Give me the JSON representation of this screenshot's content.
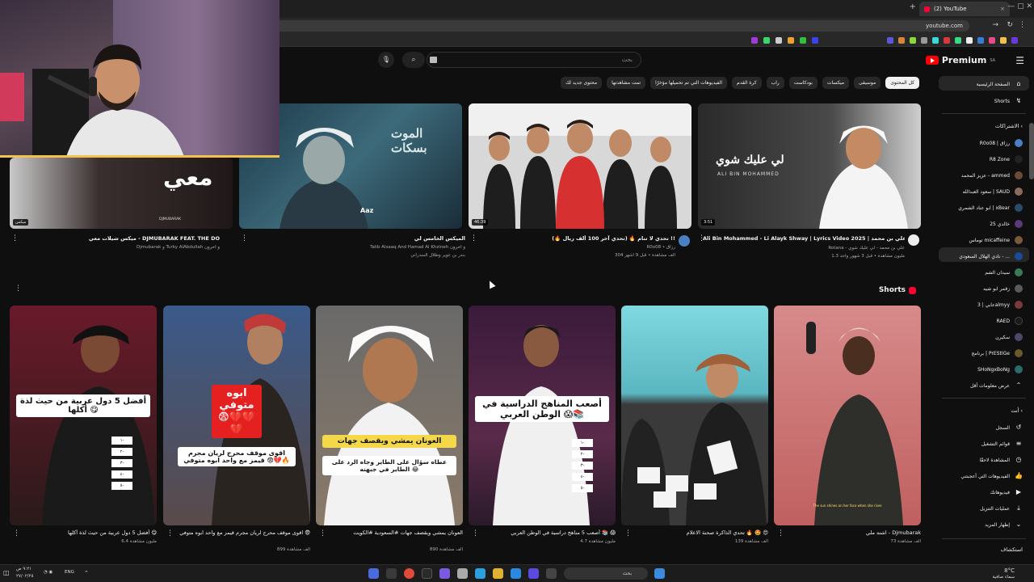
{
  "browser": {
    "tab_title": "(2) YouTube",
    "address": "youtube.com",
    "new_tab": "+",
    "tab_close": "×"
  },
  "header": {
    "logo_text": "Premium",
    "logo_sup": "SA",
    "search_placeholder": "بحث",
    "search_icon": "search-icon",
    "mic_icon": "mic-icon"
  },
  "chips": [
    {
      "label": "كل المحتوى",
      "active": true
    },
    {
      "label": "موسيقى"
    },
    {
      "label": "ميكسات"
    },
    {
      "label": "بودكاست"
    },
    {
      "label": "راب"
    },
    {
      "label": "كرة القدم"
    },
    {
      "label": "الفيديوهات التي تم تحميلها مؤخرًا"
    },
    {
      "label": "تمت مشاهدتها"
    },
    {
      "label": "محتوى جديد لك"
    }
  ],
  "videos": [
    {
      "title": "Ali Bin Mohammed - Li Alayk Shway | Lyrics Video 2025 | علي بن محمد -",
      "channel": "Rotana - علي بن محمد - لي عليك شوي",
      "meta": "1.3 مليون مشاهدة • قبل 3 شهور واحد",
      "duration": "3:51",
      "thumb_text": "لي عليك شوي",
      "thumb_sub": "ALI BIN MOHAMMED"
    },
    {
      "title": "تحدي لا تنام 🔥 (تحدي آخر 100 ألف ريال 🔥) !!",
      "channel": "R0o08 • رزاق",
      "meta": "304 ألف مشاهدة • قبل 9 أشهر",
      "duration": "46:39",
      "thumb_text": "",
      "thumb_sub": ""
    },
    {
      "title": "الميكس الخامس لي",
      "channel": "Talib Alsaaq And Hamad Al Khzineh و آخرون",
      "meta": "بندر بن عوير وطلال السدراني",
      "duration": "",
      "thumb_text": "الموت بسكات",
      "thumb_sub": "Aaz"
    },
    {
      "title": "ميكس شيلات معي - DJMUBARAK FEAT. THE DO",
      "channel": "Djmubarak و Turky AlAbdullah و آخرون",
      "meta": "",
      "duration": "ميكس",
      "thumb_text": "معي",
      "thumb_sub": "DJMUBARAK"
    }
  ],
  "shorts_header": "Shorts",
  "shorts": [
    {
      "caption": "",
      "title": "اشنه ملي - Djmubarak",
      "views": "73 ألف مشاهدة"
    },
    {
      "caption": "",
      "title": "تحدي الذاكرة صحنة الاعلام 🔥 🤩 😍",
      "views": "139 ألف مشاهدة"
    },
    {
      "caption": "أصعب المناهج الدراسية في الوطن العربي 😱📚",
      "title": "أصعب 5 مناهج دراسية في الوطن العربي 📚 😱",
      "views": "4.7 مليون مشاهدة"
    },
    {
      "caption": "العونان يمشي ويقصف جهات",
      "title": "العونان يمشي ويقصف جهات #السعودية #الكويت",
      "views": "890 ألف مشاهدة"
    },
    {
      "caption": "ابوه متوفي 😨💔💔💔",
      "title": "اقوى موقف محرج لريان مجرم قيمز مع واحد ابوه متوفي 😨",
      "views": "899 ألف مشاهدة"
    },
    {
      "caption": "أفضل 5 دول عربية من حيث لذة أكلها 😋",
      "title": "أفضل 5 دول عربية من حيث لذة أكلها 😋",
      "views": "6.4 مليون مشاهدة"
    }
  ],
  "short_captions_extra": {
    "s3_sub": "عطاه سؤال على الطاير وجاه الرد على الطاير في جبهته 😂",
    "s4_sub": "اقوى موقف محرج لريان مجرم قيمز مع واحد ابوه متوفي 😨💔🔥",
    "s1_bottom": "The sun shines on her face when she rises",
    "list_items": [
      "١-",
      "٢-",
      "٣-",
      "٤-",
      "٥-"
    ]
  },
  "sidebar": {
    "home": "الصفحة الرئيسية",
    "shorts": "Shorts",
    "subs_header": "الاشتراكات",
    "subscriptions": [
      {
        "label": "R0o08 | رزاق",
        "color": "#4a7fc1"
      },
      {
        "label": "R8 Zone",
        "color": "#222"
      },
      {
        "label": "عزيز المحمد - ammed",
        "color": "#6b4a3a"
      },
      {
        "label": "سعود العبدالله | SAUD",
        "color": "#8a6a5a"
      },
      {
        "label": "ابو عناد الشمري | xBear",
        "color": "#2a4a6a"
      },
      {
        "label": "خالدي 25",
        "color": "#5a3a7a"
      },
      {
        "label": "توماس micaffeine",
        "color": "#7a5a3a"
      },
      {
        "label": "نادي الهلال السعودي - ...",
        "color": "#1a4a9a"
      },
      {
        "label": "سيدان الشم",
        "color": "#3a7a5a"
      },
      {
        "label": "زقمر ابو شيه",
        "color": "#5a5a5a"
      },
      {
        "label": "عابي | 3almyy",
        "color": "#7a3a3a"
      },
      {
        "label": "RAED",
        "color": "#1a1a1a"
      },
      {
        "label": "سكيرن",
        "color": "#4a4a6a"
      },
      {
        "label": "برنامج | PrEStIGe",
        "color": "#6a5a2a"
      },
      {
        "label": "SHoNgxBoNg",
        "color": "#2a6a6a"
      }
    ],
    "show_more": "عرض معلومات أقل",
    "you_header": "أنت",
    "you_items": [
      {
        "label": "السجل",
        "icon": "history-icon"
      },
      {
        "label": "قوائم التشغيل",
        "icon": "playlist-icon"
      },
      {
        "label": "المشاهدة لاحقًا",
        "icon": "clock-icon"
      },
      {
        "label": "الفيديوهات التي أعجبتني",
        "icon": "like-icon"
      },
      {
        "label": "فيديوهاتك",
        "icon": "video-icon"
      },
      {
        "label": "عمليات التنزيل",
        "icon": "download-icon"
      },
      {
        "label": "إظهار المزيد",
        "icon": "chevron-down-icon"
      }
    ],
    "explore": "استكشاف"
  },
  "taskbar": {
    "weather": "8°C",
    "weather_sub": "سماء صافية",
    "search": "بحث",
    "lang": "ENG",
    "time": "٩:٢١ ص",
    "date": "٢٧/٠٢/٢٥"
  }
}
